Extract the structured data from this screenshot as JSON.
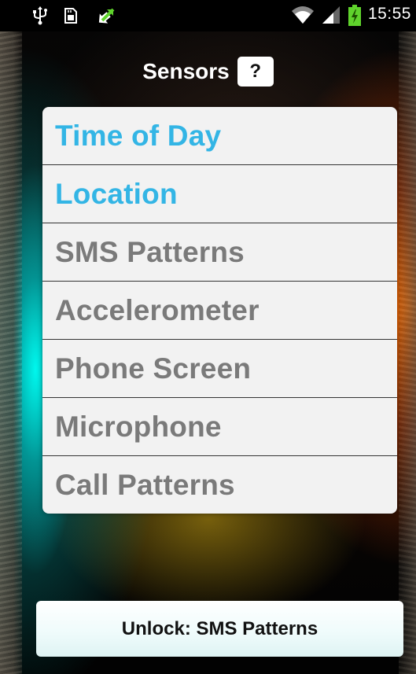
{
  "status_bar": {
    "time": "15:55",
    "icons": [
      "usb-icon",
      "sd-card-icon",
      "sync-arrows-icon",
      "wifi-icon",
      "signal-icon",
      "battery-charging-icon"
    ]
  },
  "header": {
    "title": "Sensors",
    "help_label": "?"
  },
  "sensors": [
    {
      "label": "Time of Day",
      "enabled": true
    },
    {
      "label": "Location",
      "enabled": true
    },
    {
      "label": "SMS Patterns",
      "enabled": false
    },
    {
      "label": "Accelerometer",
      "enabled": false
    },
    {
      "label": "Phone Screen",
      "enabled": false
    },
    {
      "label": "Microphone",
      "enabled": false
    },
    {
      "label": "Call Patterns",
      "enabled": false
    }
  ],
  "footer": {
    "unlock_label": "Unlock: SMS Patterns"
  },
  "colors": {
    "enabled_text": "#33b5e5",
    "disabled_text": "#7a7a7a",
    "list_background": "#f2f2f2"
  }
}
